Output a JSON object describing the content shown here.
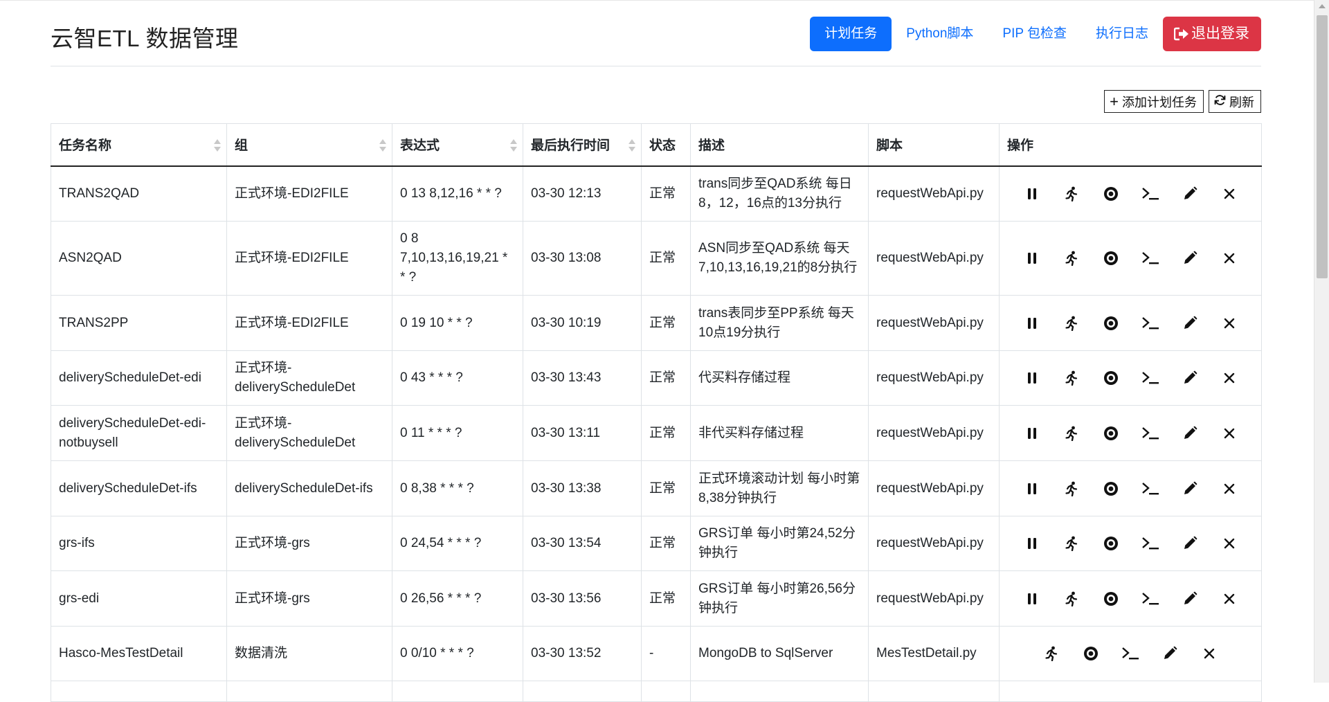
{
  "app": {
    "title": "云智ETL 数据管理"
  },
  "nav": {
    "items": [
      {
        "label": "计划任务",
        "active": true
      },
      {
        "label": "Python脚本",
        "active": false
      },
      {
        "label": "PIP 包检查",
        "active": false
      },
      {
        "label": "执行日志",
        "active": false
      }
    ],
    "logout_label": "退出登录"
  },
  "toolbar": {
    "add_label": "添加计划任务",
    "refresh_label": "刷新"
  },
  "table": {
    "columns": [
      "任务名称",
      "组",
      "表达式",
      "最后执行时间",
      "状态",
      "描述",
      "脚本",
      "操作"
    ],
    "rows": [
      {
        "name": "TRANS2QAD",
        "group": "正式环境-EDI2FILE",
        "expr": "0 13 8,12,16 * * ?",
        "last_run": "03-30 12:13",
        "status": "正常",
        "desc": "trans同步至QAD系统 每日8，12，16点的13分执行",
        "script": "requestWebApi.py",
        "pausable": true
      },
      {
        "name": "ASN2QAD",
        "group": "正式环境-EDI2FILE",
        "expr": "0 8 7,10,13,16,19,21 * * ?",
        "last_run": "03-30 13:08",
        "status": "正常",
        "desc": "ASN同步至QAD系统 每天7,10,13,16,19,21的8分执行",
        "script": "requestWebApi.py",
        "pausable": true
      },
      {
        "name": "TRANS2PP",
        "group": "正式环境-EDI2FILE",
        "expr": "0 19 10 * * ?",
        "last_run": "03-30 10:19",
        "status": "正常",
        "desc": "trans表同步至PP系统 每天10点19分执行",
        "script": "requestWebApi.py",
        "pausable": true
      },
      {
        "name": "deliveryScheduleDet-edi",
        "group": "正式环境-deliveryScheduleDet",
        "expr": "0 43 * * * ?",
        "last_run": "03-30 13:43",
        "status": "正常",
        "desc": "代买料存储过程",
        "script": "requestWebApi.py",
        "pausable": true
      },
      {
        "name": "deliveryScheduleDet-edi-notbuysell",
        "group": "正式环境-deliveryScheduleDet",
        "expr": "0 11 * * * ?",
        "last_run": "03-30 13:11",
        "status": "正常",
        "desc": "非代买料存储过程",
        "script": "requestWebApi.py",
        "pausable": true
      },
      {
        "name": "deliveryScheduleDet-ifs",
        "group": "deliveryScheduleDet-ifs",
        "expr": "0 8,38 * * * ?",
        "last_run": "03-30 13:38",
        "status": "正常",
        "desc": "正式环境滚动计划 每小时第8,38分钟执行",
        "script": "requestWebApi.py",
        "pausable": true
      },
      {
        "name": "grs-ifs",
        "group": "正式环境-grs",
        "expr": "0 24,54 * * * ?",
        "last_run": "03-30 13:54",
        "status": "正常",
        "desc": "GRS订单 每小时第24,52分钟执行",
        "script": "requestWebApi.py",
        "pausable": true
      },
      {
        "name": "grs-edi",
        "group": "正式环境-grs",
        "expr": "0 26,56 * * * ?",
        "last_run": "03-30 13:56",
        "status": "正常",
        "desc": "GRS订单 每小时第26,56分钟执行",
        "script": "requestWebApi.py",
        "pausable": true
      },
      {
        "name": "Hasco-MesTestDetail",
        "group": "数据清洗",
        "expr": "0 0/10 * * * ?",
        "last_run": "03-30 13:52",
        "status": "-",
        "desc": "MongoDB to SqlServer",
        "script": "MesTestDetail.py",
        "pausable": false
      },
      {
        "name": "",
        "group": "",
        "expr": "",
        "last_run": "",
        "status": "",
        "desc": "",
        "script": "",
        "pausable": false
      }
    ]
  },
  "icons": {
    "pause": "pause-icon",
    "run": "running-person-icon",
    "status": "target-icon",
    "console": "terminal-icon",
    "edit": "pencil-icon",
    "delete": "close-icon",
    "logout": "logout-arrow-icon",
    "add": "plus-icon",
    "refresh": "refresh-icon"
  },
  "colors": {
    "primary": "#0d6efd",
    "danger": "#dc3545"
  }
}
